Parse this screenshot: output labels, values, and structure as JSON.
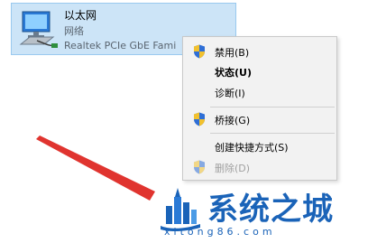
{
  "adapter": {
    "name": "以太网",
    "status": "网络",
    "device": "Realtek PCIe GbE Fami",
    "icon": "network-adapter-icon"
  },
  "context_menu": {
    "items": [
      {
        "label": "禁用(B)",
        "icon": "uac-shield-icon",
        "bold": false,
        "disabled": false
      },
      {
        "label": "状态(U)",
        "icon": "",
        "bold": true,
        "disabled": false
      },
      {
        "label": "诊断(I)",
        "icon": "",
        "bold": false,
        "disabled": false
      },
      {
        "label": "桥接(G)",
        "icon": "uac-shield-icon",
        "bold": false,
        "disabled": false
      },
      {
        "label": "创建快捷方式(S)",
        "icon": "",
        "bold": false,
        "disabled": false
      },
      {
        "label": "删除(D)",
        "icon": "uac-shield-icon",
        "bold": false,
        "disabled": true
      }
    ]
  },
  "watermark": {
    "title": "系统之城",
    "domain": "xitong86.com",
    "color": "#1a63b8"
  },
  "annotation": {
    "arrow_color": "#e0342f"
  }
}
